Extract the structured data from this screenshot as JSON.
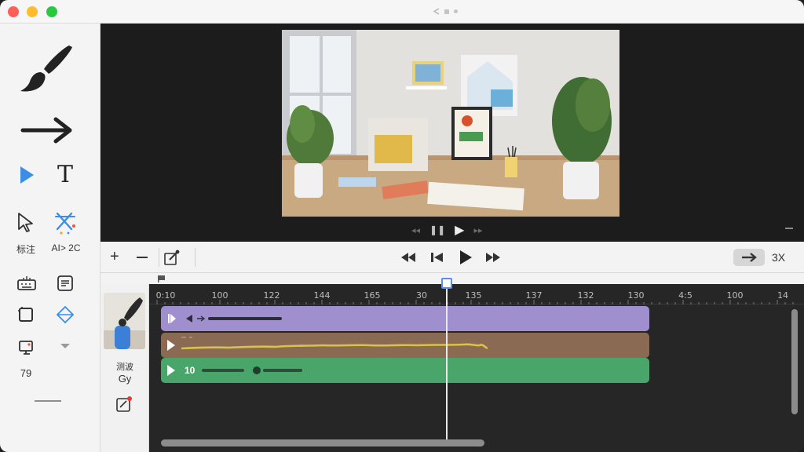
{
  "toolbar": {
    "annotate_label": "标注",
    "ai_label": "AI> 2C",
    "counter": "79"
  },
  "transport": {
    "zoom_label": "3X"
  },
  "timeline": {
    "track_label_1": "测波",
    "track_label_2": "Gy",
    "ruler_labels": [
      "0:10",
      "100",
      "122",
      "144",
      "165",
      "30",
      "135",
      "137",
      "132",
      "130",
      "4:5",
      "100",
      "14"
    ],
    "clips": [
      {
        "id": "purple",
        "color": "#a08fcf"
      },
      {
        "id": "brown",
        "color": "#8a6a52"
      },
      {
        "id": "green",
        "color": "#4aa56a",
        "label": "10"
      }
    ]
  },
  "colors": {
    "accent": "#5b8ee6",
    "play_accent": "#3a8ee6",
    "purple_clip": "#a08fcf",
    "brown_clip": "#8a6a52",
    "green_clip": "#4aa56a",
    "waveform": "#d9c24a"
  }
}
